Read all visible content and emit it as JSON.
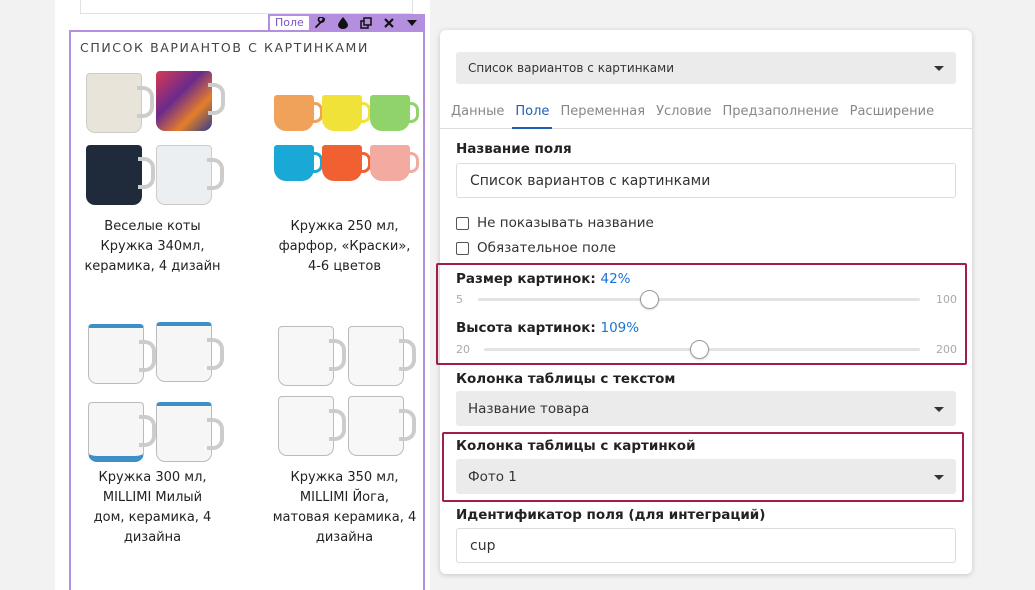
{
  "toolbar": {
    "label": "Поле",
    "icons": [
      "wrench-icon",
      "drop-icon",
      "copy-icon",
      "close-icon",
      "caret-down-icon"
    ]
  },
  "field": {
    "title": "СПИСОК ВАРИАНТОВ С КАРТИНКАМИ",
    "products": [
      {
        "caption": [
          "Веселые коты",
          "Кружка 340мл,",
          "керамика, 4 дизайн"
        ]
      },
      {
        "caption": [
          "Кружка 250 мл,",
          "фарфор, «Краски»,",
          "4-6 цветов"
        ]
      },
      {
        "caption": [
          "Кружка 300 мл,",
          "MILLIMI Милый",
          "дом, керамика, 4",
          "дизайна"
        ]
      },
      {
        "caption": [
          "Кружка 350 мл,",
          "MILLIMI Йога,",
          "матовая керамика, 4",
          "дизайна"
        ]
      }
    ]
  },
  "panel": {
    "field_type_select": "Список вариантов с картинками",
    "tabs": [
      "Данные",
      "Поле",
      "Переменная",
      "Условие",
      "Предзаполнение",
      "Расширение"
    ],
    "active_tab": "Поле",
    "name_label": "Название поля",
    "name_value": "Список вариантов с картинками",
    "hide_name": "Не показывать название",
    "required": "Обязательное поле",
    "image_size": {
      "label": "Размер картинок:",
      "value": "42%",
      "min": "5",
      "max": "100",
      "level": 42
    },
    "image_height": {
      "label": "Высота картинок:",
      "value": "109%",
      "min": "20",
      "max": "200",
      "level": 109
    },
    "text_column_label": "Колонка таблицы с текстом",
    "text_column_value": "Название товара",
    "image_column_label": "Колонка таблицы с картинкой",
    "image_column_value": "Фото 1",
    "id_label": "Идентификатор поля (для интеграций)",
    "id_value": "cup"
  },
  "colors": {
    "highlight": "#a01e4b",
    "active_tab": "#1d5fb5",
    "value_blue": "#1d73d0",
    "field_outline": "#b48fe0"
  }
}
